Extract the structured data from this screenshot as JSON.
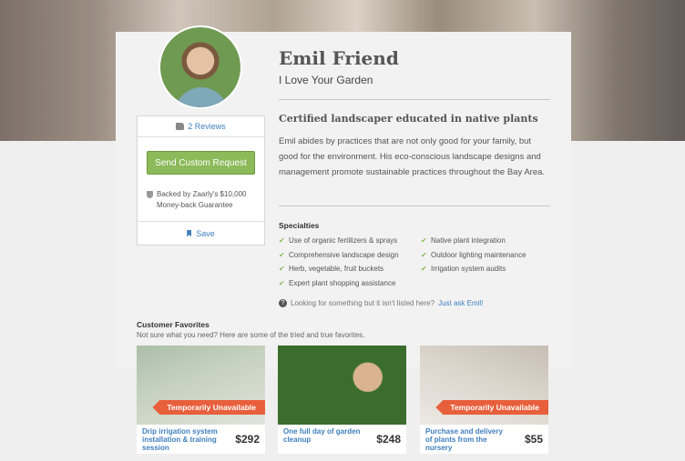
{
  "profile": {
    "name": "Emil Friend",
    "tagline": "I Love Your Garden",
    "headline": "Certified landscaper educated in native plants",
    "bio": "Emil abides by practices that are not only good for your family, but good for the environment. His eco-conscious landscape designs and management promote sustainable practices throughout the Bay Area."
  },
  "sidebar": {
    "reviews_label": "2 Reviews",
    "request_button": "Send Custom Request",
    "guarantee": "Backed by Zaarly's $10,000 Money-back Guarantee",
    "save_label": "Save"
  },
  "specialties": {
    "title": "Specialties",
    "items": [
      "Use of organic fertilizers & sprays",
      "Native plant integration",
      "Comprehensive landscape design",
      "Outdoor lighting maintenance",
      "Herb, vegetable, fruit buckets",
      "Irrigation system audits",
      "Expert plant shopping assistance"
    ]
  },
  "ask": {
    "text": "Looking for something but it isn't listed here?",
    "link": "Just ask Emil!"
  },
  "favorites": {
    "title": "Customer Favorites",
    "subtitle": "Not sure what you need? Here are some of the tried and true favorites.",
    "items": [
      {
        "name": "Drip irrigation system installation & training session",
        "price": "$292",
        "badge": "Temporarily Unavailable"
      },
      {
        "name": "One full day of garden cleanup",
        "price": "$248",
        "badge": ""
      },
      {
        "name": "Purchase and delivery of plants from the nursery",
        "price": "$55",
        "badge": "Temporarily Unavailable"
      }
    ]
  },
  "colors": {
    "accent_green": "#8cba5a",
    "link_blue": "#3f7fbf",
    "badge_orange": "#e85f3c"
  }
}
